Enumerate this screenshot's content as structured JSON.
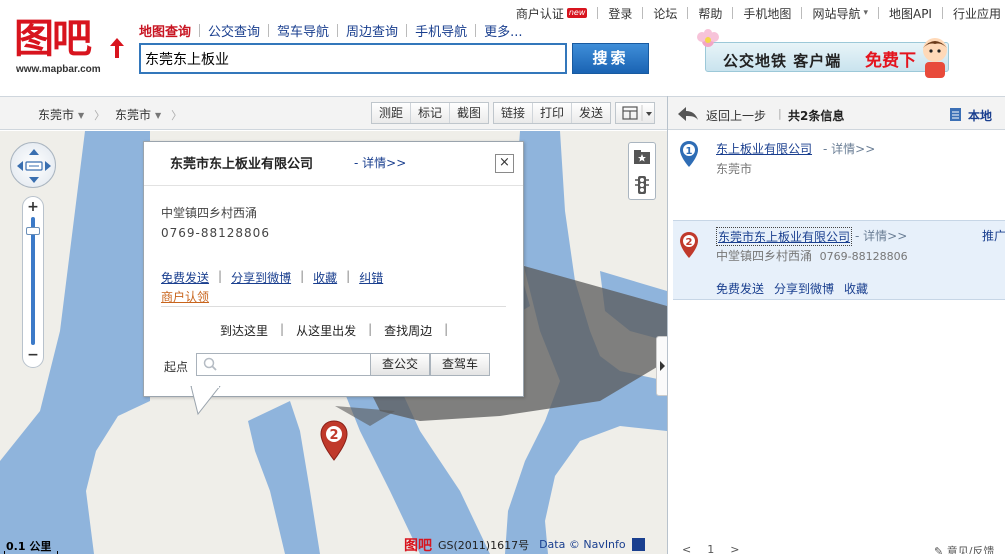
{
  "logo": {
    "text": "图吧",
    "url": "www.mapbar.com"
  },
  "topnav": {
    "items": [
      "商户认证",
      "登录",
      "论坛",
      "帮助",
      "手机地图",
      "网站导航",
      "地图API",
      "行业应用"
    ],
    "new_badge": "new"
  },
  "maintabs": [
    "地图查询",
    "公交查询",
    "驾车导航",
    "周边查询",
    "手机导航",
    "更多..."
  ],
  "search": {
    "value": "东莞东上板业",
    "button": "搜索"
  },
  "banner": {
    "text": "公交地铁 客户端",
    "free": "免费下"
  },
  "toolbar": {
    "crumbs": [
      "东莞市",
      "东莞市"
    ],
    "group1": [
      "测距",
      "标记",
      "截图"
    ],
    "group2": [
      "链接",
      "打印",
      "发送"
    ]
  },
  "infowin": {
    "title": "东莞市东上板业有限公司",
    "detail": "- 详情>>",
    "close": "×",
    "address": "中堂镇四乡村西涌",
    "phone": "0769-88128806",
    "actions": [
      "免费发送",
      "分享到微博",
      "收藏",
      "纠错"
    ],
    "cert": "商户认领",
    "routes": [
      "到达这里",
      "从这里出发",
      "查找周边"
    ],
    "start_label": "起点",
    "start_placeholder": "",
    "bus_button": "查公交",
    "car_button": "查驾车"
  },
  "marker": {
    "number": "2"
  },
  "map": {
    "scale": "0.1 公里",
    "logo": "图吧",
    "gs": "GS(2011)1617号",
    "data": "Data © NavInfo"
  },
  "sidebar": {
    "back": "返回上一步",
    "count": "共2条信息",
    "local": "本地",
    "results": [
      {
        "number": "1",
        "name": "东上板业有限公司",
        "detail": "- 详情>>",
        "sub": "东莞市"
      },
      {
        "number": "2",
        "name": "东莞市东上板业有限公司",
        "detail": "- 详情>>",
        "sub": "中堂镇四乡村西涌",
        "phone": "0769-88128806",
        "promo": "推广",
        "actions": [
          "免费发送",
          "分享到微博",
          "收藏"
        ]
      }
    ],
    "pager": [
      "<",
      "1",
      ">"
    ],
    "feedback": "意见/反馈"
  },
  "colors": {
    "brand_red": "#d8141e",
    "link_blue": "#1a3f8f",
    "water": "#8fb4dc",
    "land": "#efeee9"
  }
}
